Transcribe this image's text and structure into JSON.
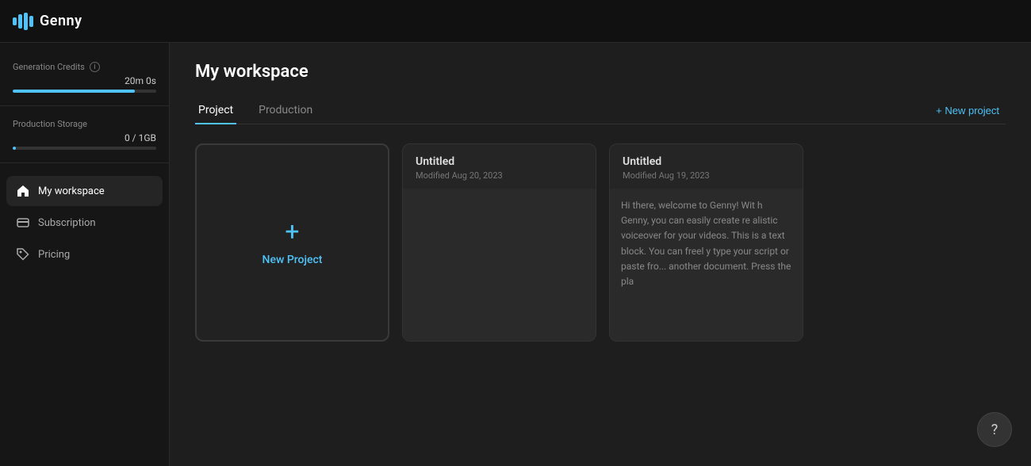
{
  "topbar": {
    "logo_text": "Genny",
    "logo_symbol": "≋"
  },
  "sidebar": {
    "credits_label": "Generation Credits",
    "credits_value": "20m 0s",
    "credits_progress_pct": 85,
    "storage_label": "Production Storage",
    "storage_value": "0 / 1GB",
    "storage_progress_pct": 2,
    "nav_items": [
      {
        "id": "my-workspace",
        "label": "My workspace",
        "icon": "home",
        "active": true
      },
      {
        "id": "subscription",
        "label": "Subscription",
        "icon": "card",
        "active": false
      },
      {
        "id": "pricing",
        "label": "Pricing",
        "icon": "tag",
        "active": false
      }
    ]
  },
  "content": {
    "title": "My workspace",
    "tabs": [
      {
        "id": "project",
        "label": "Project",
        "active": true
      },
      {
        "id": "production",
        "label": "Production",
        "active": false
      }
    ],
    "new_project_label": "+ New project",
    "new_card": {
      "plus": "+",
      "label": "New Project"
    },
    "cards": [
      {
        "title": "Untitled",
        "date": "Modified Aug 20, 2023",
        "preview": ""
      },
      {
        "title": "Untitled",
        "date": "Modified Aug 19, 2023",
        "preview": "Hi there, welcome to Genny! Wit h Genny, you can easily create re alistic voiceover for your videos. This is a text block. You can freel y type your script or paste fro... another document. Press the pla"
      }
    ]
  },
  "help": {
    "label": "?"
  }
}
